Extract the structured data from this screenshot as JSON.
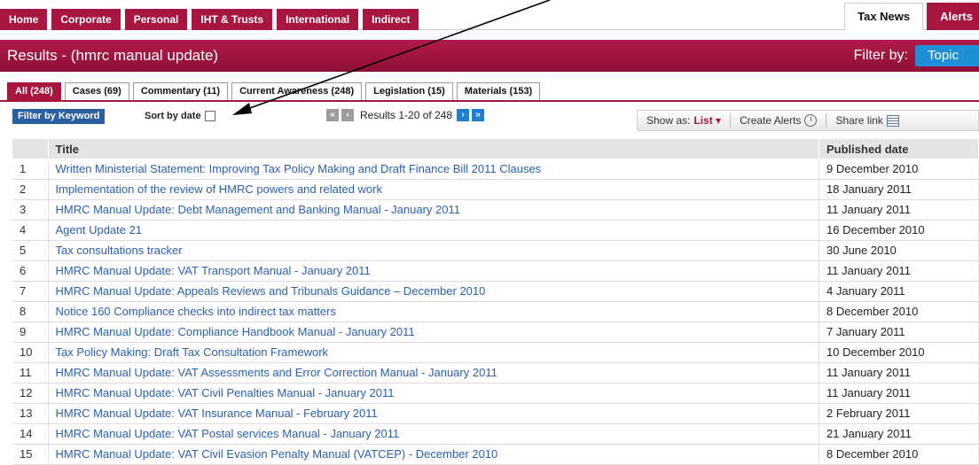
{
  "topnav": {
    "left_tabs": [
      "Home",
      "Corporate",
      "Personal",
      "IHT & Trusts",
      "International",
      "Indirect"
    ],
    "right_tabs": [
      "Tax News",
      "Alerts"
    ]
  },
  "results": {
    "title": "Results - (hmrc manual update)",
    "filter_label": "Filter by:",
    "filter_value": "Topic"
  },
  "subtabs": [
    "All (248)",
    "Cases (69)",
    "Commentary (11)",
    "Current Awareness (248)",
    "Legislation (15)",
    "Materials (153)"
  ],
  "toolbar": {
    "keyword_button": "Filter by Keyword",
    "sort_label": "Sort by date",
    "pager_text": "Results 1-20 of 248",
    "show_as_label": "Show as:",
    "show_as_value": "List ▾",
    "create_alerts": "Create Alerts",
    "share_link": "Share link"
  },
  "table": {
    "headers": [
      "",
      "Title",
      "Published date"
    ],
    "rows": [
      {
        "n": "1",
        "title": "Written Ministerial Statement: Improving Tax Policy Making and Draft Finance Bill 2011 Clauses",
        "date": "9 December 2010"
      },
      {
        "n": "2",
        "title": "Implementation of the review of HMRC powers and related work",
        "date": "18 January 2011"
      },
      {
        "n": "3",
        "title": "HMRC Manual Update: Debt Management and Banking Manual - January 2011",
        "date": "11 January 2011"
      },
      {
        "n": "4",
        "title": "Agent Update 21",
        "date": "16 December 2010"
      },
      {
        "n": "5",
        "title": "Tax consultations tracker",
        "date": "30 June 2010"
      },
      {
        "n": "6",
        "title": "HMRC Manual Update: VAT Transport Manual - January 2011",
        "date": "11 January 2011"
      },
      {
        "n": "7",
        "title": "HMRC Manual Update: Appeals Reviews and Tribunals Guidance – December 2010",
        "date": "4 January 2011"
      },
      {
        "n": "8",
        "title": "Notice 160 Compliance checks into indirect tax matters",
        "date": "8 December 2010"
      },
      {
        "n": "9",
        "title": "HMRC Manual Update: Compliance Handbook Manual - January 2011",
        "date": "7 January 2011"
      },
      {
        "n": "10",
        "title": "Tax Policy Making: Draft Tax Consultation Framework",
        "date": "10 December 2010"
      },
      {
        "n": "11",
        "title": "HMRC Manual Update: VAT Assessments and Error Correction Manual - January 2011",
        "date": "11 January 2011"
      },
      {
        "n": "12",
        "title": "HMRC Manual Update: VAT Civil Penalties Manual - January 2011",
        "date": "11 January 2011"
      },
      {
        "n": "13",
        "title": "HMRC Manual Update: VAT Insurance Manual - February 2011",
        "date": "2 February 2011"
      },
      {
        "n": "14",
        "title": "HMRC Manual Update: VAT Postal services Manual - January 2011",
        "date": "21 January 2011"
      },
      {
        "n": "15",
        "title": "HMRC Manual Update: VAT Civil Evasion Penalty Manual (VATCEP) - December 2010",
        "date": "8 December 2010"
      }
    ]
  },
  "colors": {
    "brand": "#a8153f",
    "link": "#2a5fb0",
    "topic_button": "#1f8fd8"
  }
}
